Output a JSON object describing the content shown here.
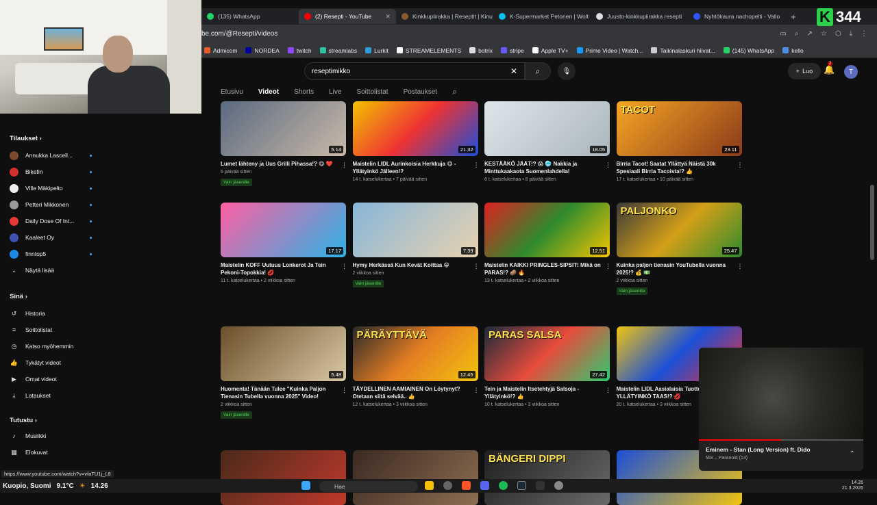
{
  "browser": {
    "tabs": [
      {
        "label": "(135) WhatsApp",
        "color": "#25d366"
      },
      {
        "label": "(2) Resepti - YouTube",
        "color": "#ff0000",
        "active": true
      },
      {
        "label": "Kinkkupiirakka | Reseptit | Kinu",
        "color": "#8b5a2b"
      },
      {
        "label": "K-Supermarket Petonen | Wolt",
        "color": "#00c2e8"
      },
      {
        "label": "Juusto-kinkkupiirakka resepti",
        "color": "#dddddd"
      },
      {
        "label": "Nyhtökaura nachopelti - Valio",
        "color": "#3355ff"
      }
    ],
    "url": "be.com/@Resepti/videos",
    "bookmarks": [
      {
        "label": "Admicom",
        "color": "#e85b26"
      },
      {
        "label": "NORDEA",
        "color": "#0000a0"
      },
      {
        "label": "twitch",
        "color": "#9146ff"
      },
      {
        "label": "streamlabs",
        "color": "#31c3a2"
      },
      {
        "label": "Lurkit",
        "color": "#2d9cdb"
      },
      {
        "label": "STREAMELEMENTS",
        "color": "#ffffff"
      },
      {
        "label": "botrix",
        "color": "#dddddd"
      },
      {
        "label": "stripe",
        "color": "#635bff"
      },
      {
        "label": "Apple TV+",
        "color": "#ffffff"
      },
      {
        "label": "Prime Video | Watch...",
        "color": "#1a98ff"
      },
      {
        "label": "Taikinalaskuri hiivat...",
        "color": "#cccccc"
      },
      {
        "label": "(145) WhatsApp",
        "color": "#25d366"
      },
      {
        "label": "kello",
        "color": "#4a90e2"
      }
    ]
  },
  "brand": {
    "letter": "K",
    "number": "344"
  },
  "youtube": {
    "search_value": "reseptimikko",
    "create_label": "Luo",
    "notif_count": "2",
    "avatar_letter": "T",
    "channel_tabs": [
      "Etusivu",
      "Videot",
      "Shorts",
      "Live",
      "Soittolistat",
      "Postaukset"
    ]
  },
  "sidebar": {
    "subs_heading": "Tilaukset",
    "subs": [
      {
        "label": "Annukka Lascell...",
        "color": "#7a4a2a"
      },
      {
        "label": "Bikefin",
        "color": "#d32f2f"
      },
      {
        "label": "Ville Mäkipelto",
        "color": "#eeeeee"
      },
      {
        "label": "Petteri Mikkonen",
        "color": "#999999"
      },
      {
        "label": "Daily Dose Of Int...",
        "color": "#e53935"
      },
      {
        "label": "Kaaleet Oy",
        "color": "#3f51b5"
      },
      {
        "label": "finntop5",
        "color": "#1e88e5"
      }
    ],
    "show_more": "Näytä lisää",
    "you_heading": "Sinä",
    "you_items": [
      "Historia",
      "Soittolistat",
      "Katso myöhemmin",
      "Tykätyt videot",
      "Omat videot",
      "Lataukset"
    ],
    "explore_heading": "Tutustu",
    "explore_items": [
      "Musiikki",
      "Elokuvat"
    ]
  },
  "videos": [
    {
      "title": "Lumet lähteny ja Uus Grilli Pihassa!? 😋 ❤️",
      "meta": "5 päivää sitten",
      "members": "Vain jäsenille",
      "duration": "5.14",
      "bg": "linear-gradient(135deg,#5a6a80,#c9b9a8)",
      "overlay": ""
    },
    {
      "title": "Maistelin LIDL Aurinkoisia Herkkuja 😋 - Yllätyinkö Jälleen!?",
      "meta": "14 t. katselukertaa • 7 päivää sitten",
      "members": "",
      "duration": "21.32",
      "bg": "linear-gradient(135deg,#f2c200,#e33,#1b4fd8)",
      "overlay": ""
    },
    {
      "title": "KESTÄÄKÖ JÄÄT!? 😱 🥶 Nakkia ja Minttukaakaota Suomenlahdella!",
      "meta": "6 t. katselukertaa • 8 päivää sitten",
      "members": "",
      "duration": "18.05",
      "bg": "linear-gradient(135deg,#dfe6ea,#aab6bd)",
      "overlay": ""
    },
    {
      "title": "Birria Tacot! Saatat Yllättyä Näistä 30k Spesiaali Birria Tacoista!? 👍",
      "meta": "17 t. katselukertaa • 10 päivää sitten",
      "members": "",
      "duration": "23.11",
      "bg": "linear-gradient(135deg,#f5a623,#8b3a1a)",
      "overlay": "TACOT"
    },
    {
      "title": "Maistelin KOFF Uutuus Lonkerot Ja Tein Pekoni-Topokkia! 💋",
      "meta": "11 t. katselukertaa • 2 viikkoa sitten",
      "members": "",
      "duration": "17.17",
      "bg": "linear-gradient(135deg,#ff5fa2,#2bb3e6)",
      "overlay": ""
    },
    {
      "title": "Hymy Herkässä Kun Kevät Koittaa 😁",
      "meta": "2 viikkoa sitten",
      "members": "Vain jäsenille",
      "duration": "7.39",
      "bg": "linear-gradient(135deg,#87b6d9,#e8d2b0)",
      "overlay": ""
    },
    {
      "title": "Maistelin KAIKKI PRINGLES-SIPSIT! Mikä on PARAS!? 🥔 🔥",
      "meta": "13 t. katselukertaa • 2 viikkoa sitten",
      "members": "",
      "duration": "12.51",
      "bg": "linear-gradient(135deg,#e02020,#2e8b2e,#f5c400)",
      "overlay": ""
    },
    {
      "title": "Kuinka paljon tienasin YouTubella vuonna 2025!? 💰 💵",
      "meta": "2 viikkoa sitten",
      "members": "Vain jäsenille",
      "duration": "25.47",
      "bg": "linear-gradient(135deg,#3a3a3a,#d4a017,#2e8b2e)",
      "overlay": "PALJONKO"
    },
    {
      "title": "Huomenta! Tänään Tulee \"Kuinka Paljon Tienasin Tubella vuonna 2025\" Video!",
      "meta": "2 viikkoa sitten",
      "members": "Vain jäsenille",
      "duration": "5.48",
      "bg": "linear-gradient(135deg,#6b4f2a,#d8c9a3)",
      "overlay": ""
    },
    {
      "title": "TÄYDELLINEN AAMIAINEN On Löytynyt? Otetaan siitä selvää.. 👍",
      "meta": "12 t. katselukertaa • 3 viikkoa sitten",
      "members": "",
      "duration": "12.45",
      "bg": "linear-gradient(135deg,#2a2a2a,#e67e22,#f1c40f)",
      "overlay": "PÄRÄYTTÄVÄ"
    },
    {
      "title": "Tein ja Maistelin Itsetehtyjä Salsoja - Yllätyinkö!? 👍",
      "meta": "10 t. katselukertaa • 3 viikkoa sitten",
      "members": "",
      "duration": "27.42",
      "bg": "linear-gradient(135deg,#1a2a3a,#e74c3c,#2ecc71)",
      "overlay": "PARAS   SALSA"
    },
    {
      "title": "Maistelin LIDL Aasialaisia Tuotte... YLLÄTYINKÖ TAAS!? 💋",
      "meta": "20 t. katselukertaa • 3 viikkoa sitten",
      "members": "",
      "duration": "",
      "bg": "linear-gradient(135deg,#f1c40f,#1b4fd8,#e33)",
      "overlay": ""
    },
    {
      "title": "",
      "meta": "",
      "members": "",
      "duration": "",
      "bg": "linear-gradient(135deg,#4a2a1a,#c0392b)",
      "overlay": ""
    },
    {
      "title": "",
      "meta": "",
      "members": "",
      "duration": "",
      "bg": "linear-gradient(135deg,#3a2a22,#8e6e52)",
      "overlay": ""
    },
    {
      "title": "",
      "meta": "",
      "members": "",
      "duration": "",
      "bg": "linear-gradient(135deg,#1f1f1f,#6a6a6a)",
      "overlay": "BÄNGERI DIPPI"
    },
    {
      "title": "",
      "meta": "",
      "members": "",
      "duration": "",
      "bg": "linear-gradient(135deg,#1b4fd8,#f1c40f)",
      "overlay": ""
    }
  ],
  "miniplayer": {
    "title": "Eminem - Stan (Long Version) ft. Dido",
    "subtitle": "Mix – Paranoid (13)",
    "progress": 0.5
  },
  "status_url": "https://www.youtube.com/watch?v=vfaTU1j_L8",
  "taskbar": {
    "location": "Kuopio, Suomi",
    "temp": "9.1°C",
    "left_time": "14.26",
    "search_placeholder": "Hae",
    "time": "14.26",
    "date": "21.3.2026"
  }
}
